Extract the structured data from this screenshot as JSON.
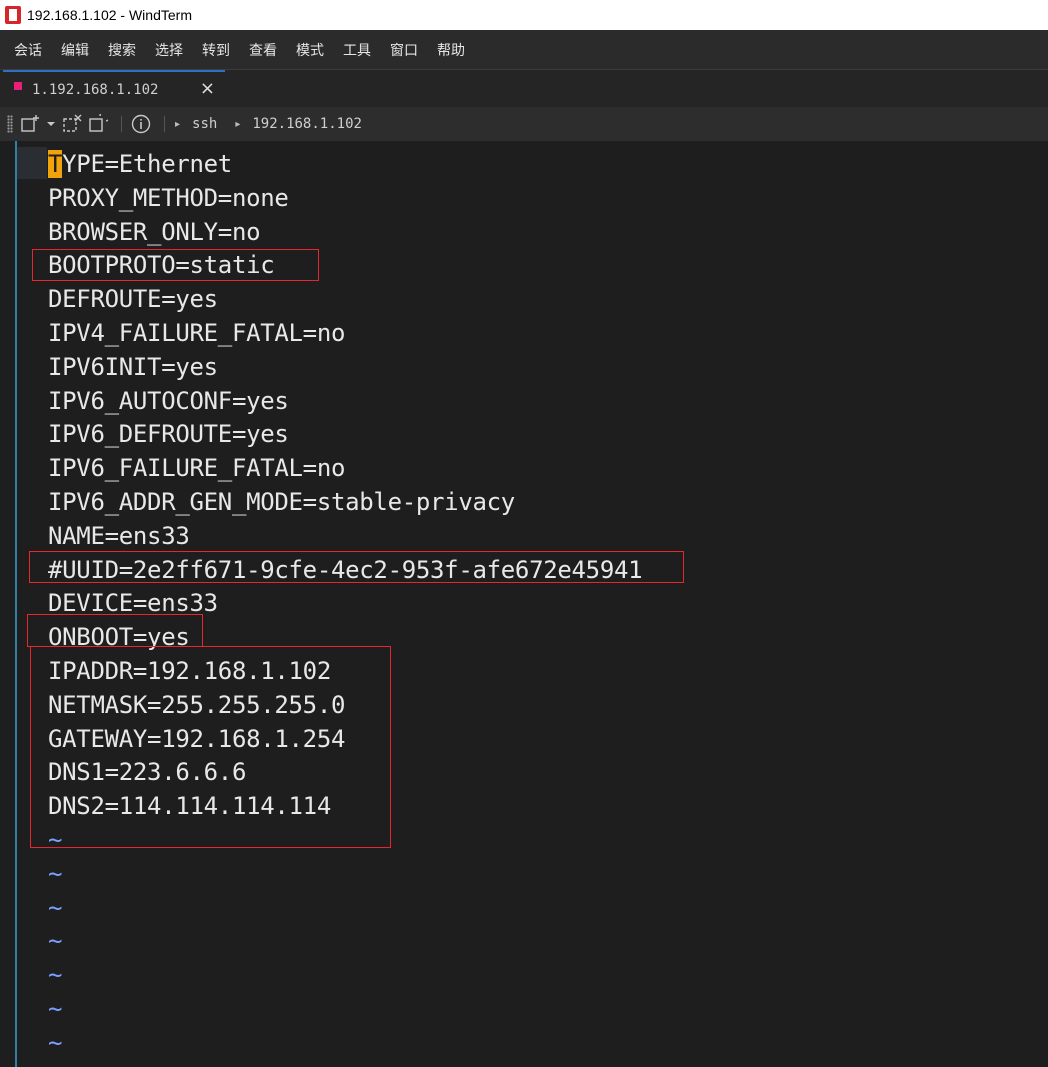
{
  "window": {
    "title": "192.168.1.102 - WindTerm",
    "app_icon": "windterm-logo-icon"
  },
  "menu": [
    "会话",
    "编辑",
    "搜索",
    "选择",
    "转到",
    "查看",
    "模式",
    "工具",
    "窗口",
    "帮助"
  ],
  "tab": {
    "label": "1.192.168.1.102",
    "dot_color": "#e91e79",
    "close_glyph": "×"
  },
  "toolbar": {
    "breadcrumb": [
      "ssh",
      "192.168.1.102"
    ]
  },
  "editor": {
    "cursor_char": "T",
    "first_line_rest": "YPE=Ethernet",
    "lines": [
      "PROXY_METHOD=none",
      "BROWSER_ONLY=no",
      "BOOTPROTO=static",
      "DEFROUTE=yes",
      "IPV4_FAILURE_FATAL=no",
      "IPV6INIT=yes",
      "IPV6_AUTOCONF=yes",
      "IPV6_DEFROUTE=yes",
      "IPV6_FAILURE_FATAL=no",
      "IPV6_ADDR_GEN_MODE=stable-privacy",
      "NAME=ens33",
      "#UUID=2e2ff671-9cfe-4ec2-953f-afe672e45941",
      "DEVICE=ens33",
      "ONBOOT=yes",
      "IPADDR=192.168.1.102",
      "NETMASK=255.255.255.0",
      "GATEWAY=192.168.1.254",
      "DNS1=223.6.6.6",
      "DNS2=114.114.114.114"
    ],
    "tilde": "~",
    "tilde_count": 7
  },
  "colors": {
    "annotation": "#e5282d",
    "cursor": "#f0a30a",
    "tilde": "#7aa0ff"
  }
}
